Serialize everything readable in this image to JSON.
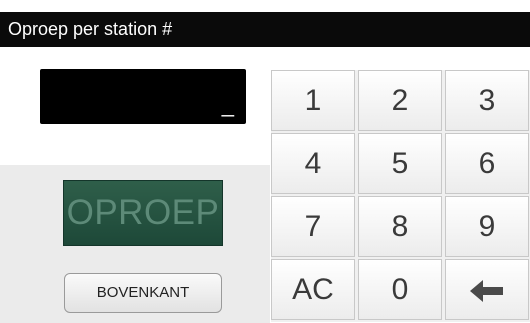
{
  "header": {
    "title": "Oproep per station #"
  },
  "display": {
    "value": "_"
  },
  "actions": {
    "call_label": "OPROEP",
    "top_label": "BOVENKANT"
  },
  "keypad": {
    "keys": [
      "1",
      "2",
      "3",
      "4",
      "5",
      "6",
      "7",
      "8",
      "9",
      "AC",
      "0"
    ],
    "backspace_icon": "arrow-left-icon"
  },
  "colors": {
    "title_bar": "#0a0a0a",
    "call_button": "#2a5a45",
    "call_text": "#5d8a78"
  }
}
